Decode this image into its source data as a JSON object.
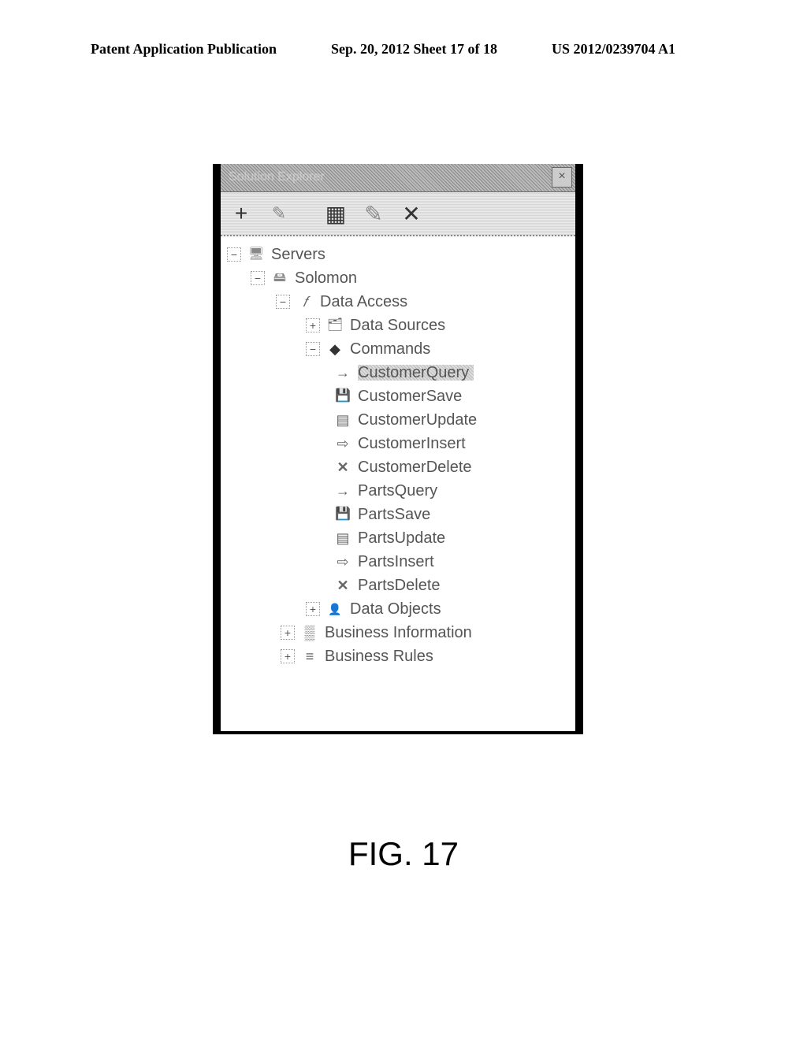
{
  "header": {
    "left": "Patent Application Publication",
    "mid": "Sep. 20, 2012  Sheet 17 of 18",
    "right": "US 2012/0239704 A1"
  },
  "panel": {
    "title": "Solution Explorer",
    "close": "×"
  },
  "toolbar": {
    "add": "+",
    "wand": "✎",
    "grid": "▦",
    "edit": "✎",
    "del": "✕"
  },
  "tree": {
    "servers": "Servers",
    "solomon": "Solomon",
    "data_access": "Data Access",
    "data_sources": "Data Sources",
    "commands": "Commands",
    "items": [
      {
        "icon": "query",
        "label": "CustomerQuery",
        "selected": true
      },
      {
        "icon": "save",
        "label": "CustomerSave"
      },
      {
        "icon": "update",
        "label": "CustomerUpdate"
      },
      {
        "icon": "insert",
        "label": "CustomerInsert"
      },
      {
        "icon": "delete",
        "label": "CustomerDelete"
      },
      {
        "icon": "query",
        "label": "PartsQuery"
      },
      {
        "icon": "save",
        "label": "PartsSave"
      },
      {
        "icon": "update",
        "label": "PartsUpdate"
      },
      {
        "icon": "insert",
        "label": "PartsInsert"
      },
      {
        "icon": "delete",
        "label": "PartsDelete"
      }
    ],
    "data_objects": "Data Objects",
    "business_info": "Business Information",
    "business_rules": "Business Rules"
  },
  "expanders": {
    "minus": "−",
    "plus": "+"
  },
  "caption": "FIG. 17"
}
